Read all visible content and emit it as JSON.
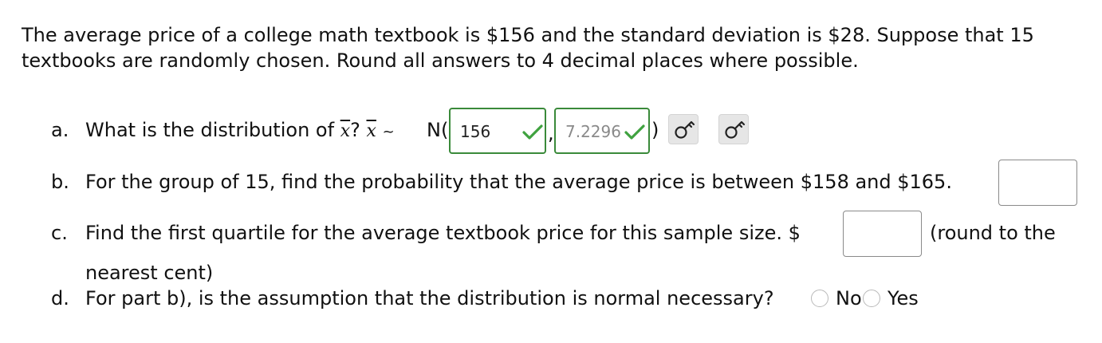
{
  "intro": {
    "line1": "The average price of a college math textbook is $156 and the standard deviation is $28. Suppose that 15",
    "line2": "textbooks are randomly chosen. Round all answers to 4 decimal places where possible."
  },
  "question_a": {
    "label": "a.",
    "text_before": "What is the distribution of",
    "xbar": "x",
    "q_mark": "?",
    "tilde": "~",
    "n_open": "N(",
    "mean_value": "156",
    "comma": ",",
    "sd_value": "7.2296",
    "close_paren": ")"
  },
  "question_b": {
    "label": "b.",
    "text": "For the group of 15, find the probability that the average price is between $158 and $165.",
    "answer": ""
  },
  "question_c": {
    "label": "c.",
    "text": "Find the first quartile for the average textbook price for this sample size. $",
    "answer": "",
    "suffix": "(round to the",
    "line2": "nearest cent)"
  },
  "question_d": {
    "label": "d.",
    "text": "For part b), is the assumption that the distribution is normal necessary?",
    "options": [
      "No",
      "Yes"
    ]
  },
  "colors": {
    "correct": "#3a8a3a",
    "check": "#3fa23f",
    "key_button_bg": "#e6e6e6"
  },
  "icons": [
    "check-icon",
    "key-icon"
  ]
}
